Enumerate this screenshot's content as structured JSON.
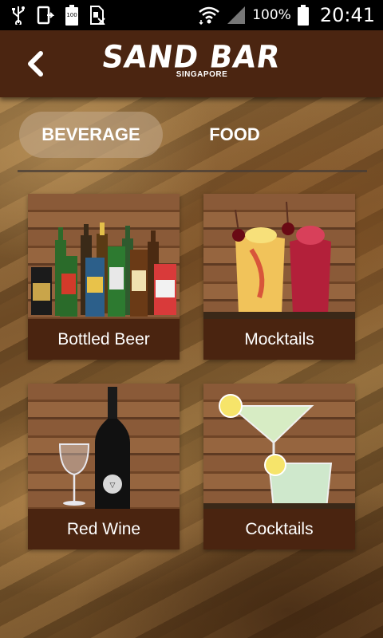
{
  "status_bar": {
    "battery_percent": "100%",
    "time": "20:41",
    "icons": [
      "usb-icon",
      "screen-rotate-icon",
      "battery-small-icon",
      "sim-card-icon",
      "wifi-icon",
      "signal-icon",
      "battery-icon"
    ]
  },
  "header": {
    "logo_title": "SAND BAR",
    "logo_subtitle": "SINGAPORE",
    "back_icon": "chevron-left-icon"
  },
  "tabs": [
    {
      "label": "BEVERAGE",
      "active": true
    },
    {
      "label": "FOOD",
      "active": false
    }
  ],
  "categories": [
    {
      "label": "Bottled Beer",
      "image": "beer-bottles-image"
    },
    {
      "label": "Mocktails",
      "image": "mocktail-glasses-image"
    },
    {
      "label": "Red Wine",
      "image": "wine-bottle-image"
    },
    {
      "label": "Cocktails",
      "image": "cocktail-glasses-image"
    }
  ],
  "colors": {
    "header_bg": "#4b2511",
    "label_bg": "#4a2410",
    "active_tab_bg": "#c3aa8c"
  }
}
